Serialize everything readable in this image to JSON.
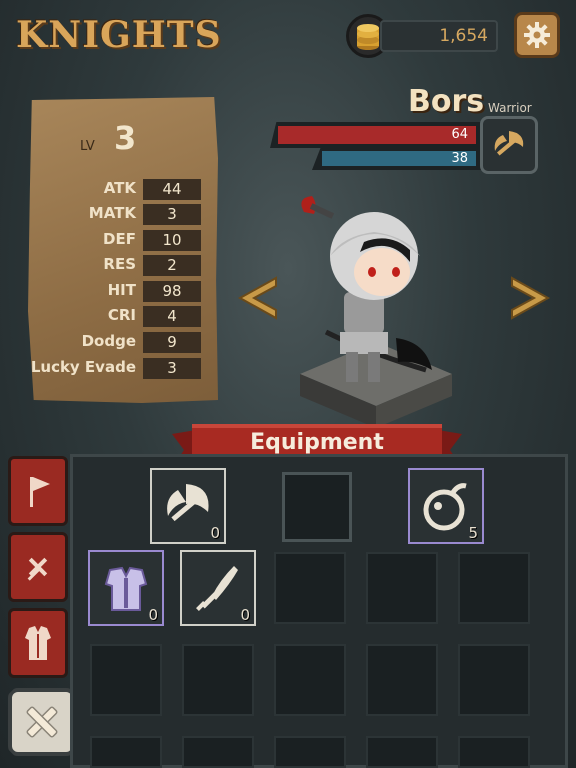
{
  "header": {
    "title": "KNIGHTS",
    "gold": "1,654"
  },
  "stats": {
    "lv_label": "LV",
    "lv_value": "3",
    "rows": [
      {
        "name": "ATK",
        "value": "44"
      },
      {
        "name": "MATK",
        "value": "3"
      },
      {
        "name": "DEF",
        "value": "10"
      },
      {
        "name": "RES",
        "value": "2"
      },
      {
        "name": "HIT",
        "value": "98"
      },
      {
        "name": "CRI",
        "value": "4"
      },
      {
        "name": "Dodge",
        "value": "9"
      },
      {
        "name": "Lucky Evade",
        "value": "3"
      }
    ]
  },
  "character": {
    "name": "Bors",
    "class": "Warrior",
    "hp": "64",
    "mp": "38"
  },
  "nav": {
    "prev": "<",
    "next": ">"
  },
  "equipment": {
    "title": "Equipment",
    "slots": [
      {
        "icon": "axe-icon",
        "qty": "0",
        "rarity": "white"
      },
      {
        "icon": "empty-slot",
        "qty": "",
        "rarity": "none"
      },
      {
        "icon": "bomb-icon",
        "qty": "5",
        "rarity": "purple"
      },
      {
        "icon": "armor-icon",
        "qty": "0",
        "rarity": "purple"
      },
      {
        "icon": "sword-icon",
        "qty": "0",
        "rarity": "white"
      }
    ]
  },
  "colors": {
    "gold_text": "#d6a860",
    "hp": "#a82a2a",
    "mp": "#2f6a82",
    "tab_red": "#9a2a22",
    "purple_rarity": "#9a8ad0"
  }
}
